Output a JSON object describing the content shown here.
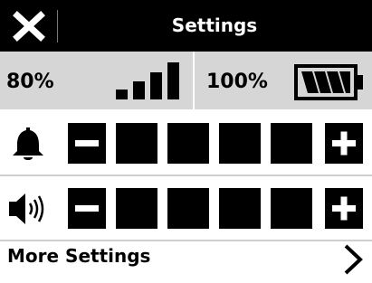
{
  "header": {
    "title": "Settings",
    "close_icon": "close-x-icon"
  },
  "status": {
    "signal_text": "80%",
    "signal_icon": "signal-strength-icon",
    "battery_text": "100%",
    "battery_icon": "battery-full-icon"
  },
  "ringer": {
    "icon": "bell-icon",
    "level": 0,
    "max_level": 5,
    "decrease_icon": "minus-icon",
    "increase_icon": "plus-icon"
  },
  "volume": {
    "icon": "speaker-volume-icon",
    "level": 0,
    "max_level": 5,
    "decrease_icon": "minus-icon",
    "increase_icon": "plus-icon"
  },
  "more": {
    "label": "More Settings",
    "icon": "chevron-right-icon"
  },
  "colors": {
    "header_bg": "#000000",
    "status_bg": "#d6d6d6",
    "foreground": "#000000",
    "background": "#ffffff"
  }
}
